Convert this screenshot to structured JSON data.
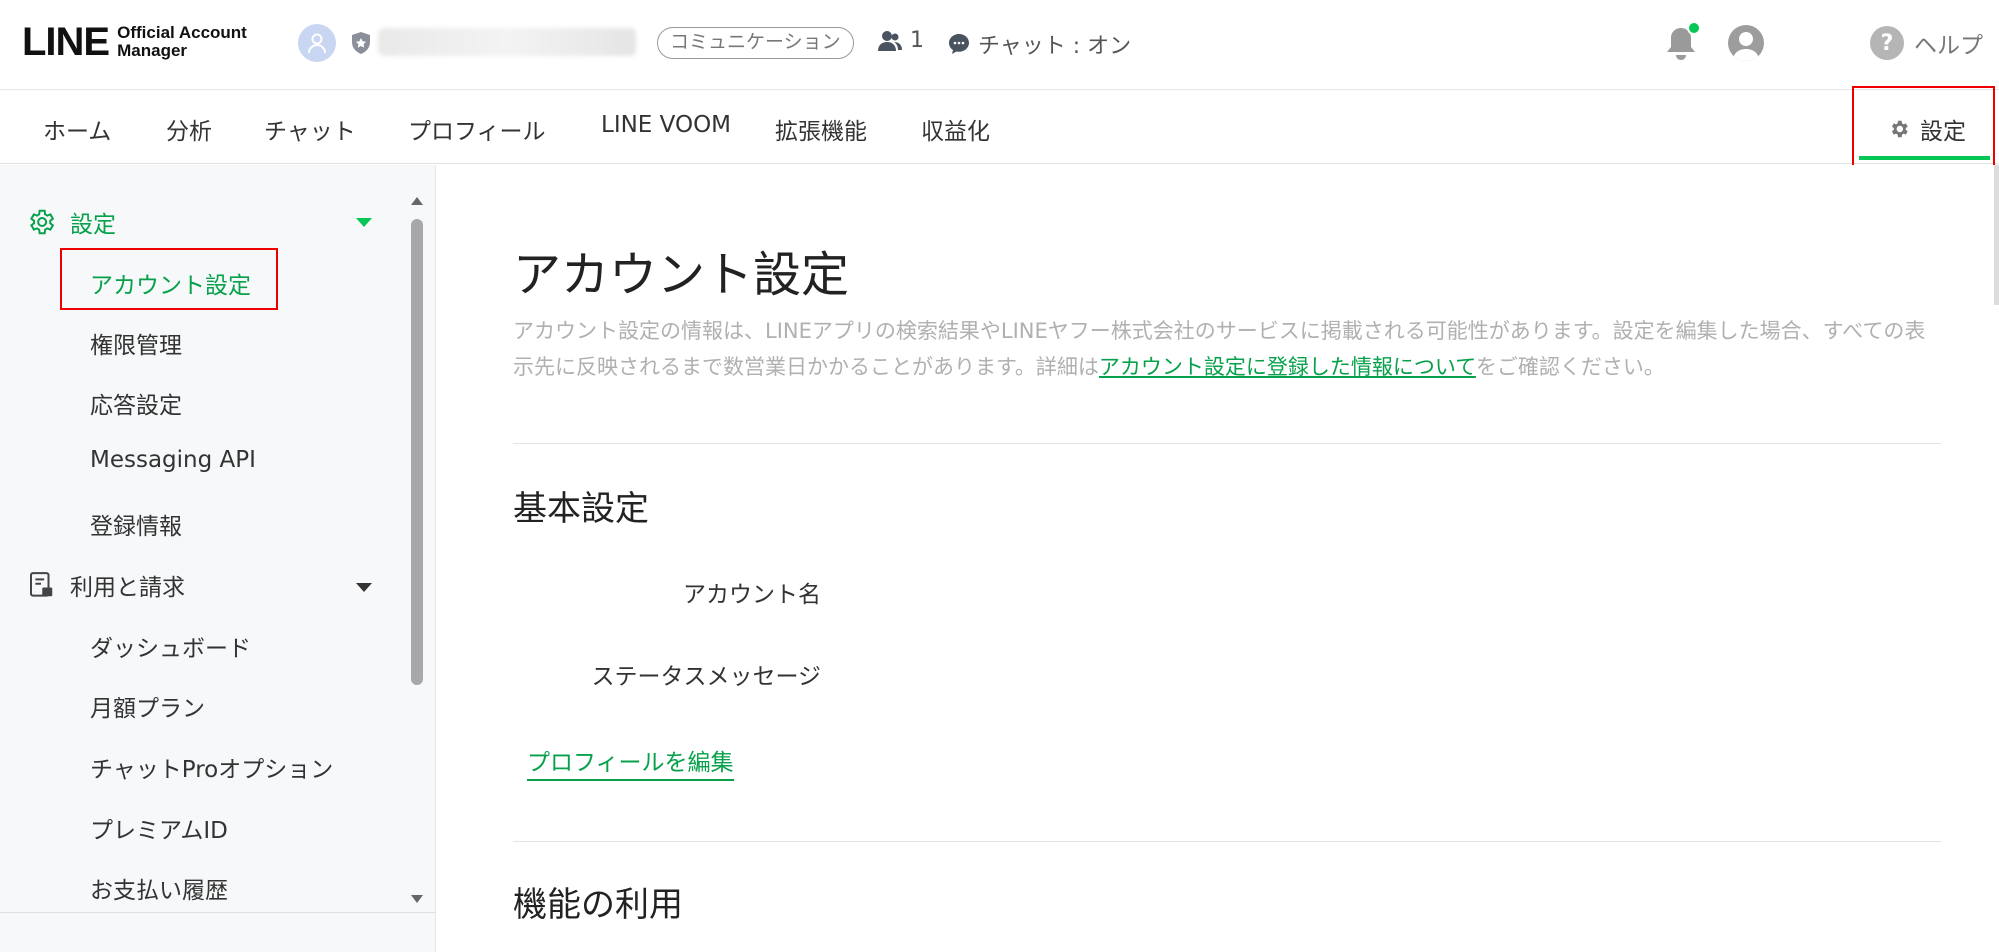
{
  "header": {
    "logo_main": "LINE",
    "logo_sub_line1": "Official Account",
    "logo_sub_line2": "Manager",
    "account_type_badge": "コミュニケーション",
    "friends_count": "1",
    "chat_status": "チャット : オン",
    "help_label": "ヘルプ",
    "help_icon_text": "?"
  },
  "nav": {
    "tabs": [
      {
        "label": "ホーム"
      },
      {
        "label": "分析"
      },
      {
        "label": "チャット"
      },
      {
        "label": "プロフィール"
      },
      {
        "label": "LINE VOOM"
      },
      {
        "label": "拡張機能"
      },
      {
        "label": "収益化"
      }
    ],
    "settings_label": "設定",
    "active": "設定"
  },
  "sidebar": {
    "section_settings": {
      "label": "設定",
      "items": [
        {
          "label": "アカウント設定",
          "selected": true
        },
        {
          "label": "権限管理"
        },
        {
          "label": "応答設定"
        },
        {
          "label": "Messaging API"
        },
        {
          "label": "登録情報"
        }
      ]
    },
    "section_billing": {
      "label": "利用と請求",
      "items": [
        {
          "label": "ダッシュボード"
        },
        {
          "label": "月額プラン"
        },
        {
          "label": "チャットProオプション"
        },
        {
          "label": "プレミアムID"
        },
        {
          "label": "お支払い履歴"
        }
      ]
    }
  },
  "main": {
    "title": "アカウント設定",
    "description_before_link": "アカウント設定の情報は、LINEアプリの検索結果やLINEヤフー株式会社のサービスに掲載される可能性があります。設定を編集した場合、すべての表示先に反映されるまで数営業日かかることがあります。詳細は",
    "description_link": "アカウント設定に登録した情報について",
    "description_after_link": "をご確認ください。",
    "basic_section": "基本設定",
    "field_account_name": "アカウント名",
    "field_status_message": "ステータスメッセージ",
    "edit_profile_link": "プロフィールを編集",
    "features_section": "機能の利用"
  },
  "colors": {
    "accent": "#06c755",
    "link": "#06a14a",
    "highlight_box": "#e00000"
  }
}
